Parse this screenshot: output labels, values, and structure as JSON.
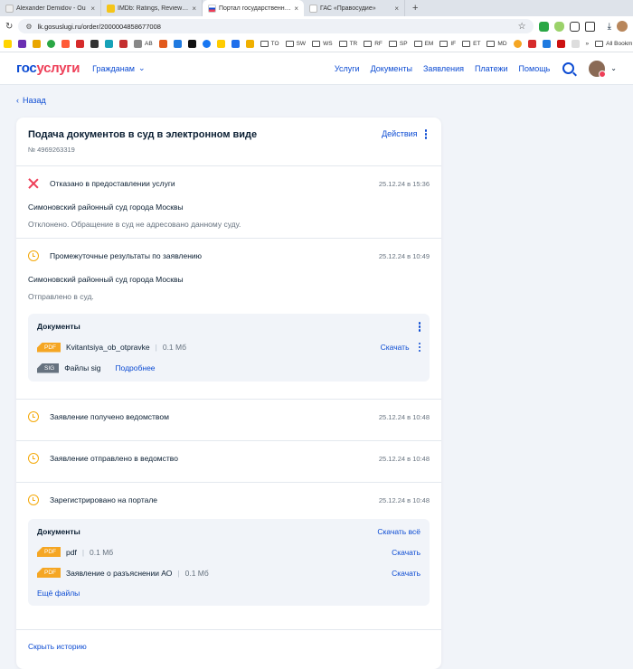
{
  "browser": {
    "tabs": [
      {
        "label": "Alexander Demidov - Ou",
        "active": false,
        "color": "#ffffff"
      },
      {
        "label": "IMDb: Ratings, Reviews, and W",
        "active": false,
        "color": "#f5c518"
      },
      {
        "label": "Портал государственных услу",
        "active": true,
        "color": "#0d4cd3"
      },
      {
        "label": "ГАС «Правосудие»",
        "active": false,
        "color": "#ffffff"
      }
    ],
    "url": "lk.gosuslugi.ru/order/2000004858677008",
    "bookmarks": [
      "AB",
      "TO",
      "SW",
      "WS",
      "TR",
      "RF",
      "SP",
      "EM",
      "IF",
      "ET",
      "MD"
    ],
    "all_bookmarks": "All Bookm"
  },
  "header": {
    "logo_a": "гос",
    "logo_b": "услуги",
    "role": "Гражданам",
    "nav": [
      "Услуги",
      "Документы",
      "Заявления",
      "Платежи",
      "Помощь"
    ]
  },
  "back": "Назад",
  "order": {
    "title": "Подача документов в суд в электронном виде",
    "number": "№ 4969263319",
    "actions": "Действия"
  },
  "events": {
    "refused": {
      "status": "Отказано в предоставлении услуги",
      "time": "25.12.24 в 15:36",
      "court": "Симоновский районный суд города Москвы",
      "note": "Отклонено. Обращение в суд не адресовано данному суду."
    },
    "interim": {
      "status": "Промежуточные результаты по заявлению",
      "time": "25.12.24 в 10:49",
      "court": "Симоновский районный суд города Москвы",
      "note": "Отправлено в суд.",
      "docs_title": "Документы",
      "doc1_type": "PDF",
      "doc1_name": "Kvitantsiya_ob_otpravke",
      "doc1_size": "0.1 Мб",
      "doc1_action": "Скачать",
      "doc2_type": "SIG",
      "doc2_name": "Файлы sig",
      "doc2_more": "Подробнее"
    },
    "received": {
      "status": "Заявление получено ведомством",
      "time": "25.12.24 в 10:48"
    },
    "sent": {
      "status": "Заявление отправлено в ведомство",
      "time": "25.12.24 в 10:48"
    },
    "registered": {
      "status": "Зарегистрировано на портале",
      "time": "25.12.24 в 10:48",
      "docs_title": "Документы",
      "download_all": "Скачать всё",
      "doc1_type": "PDF",
      "doc1_name": "pdf",
      "doc1_size": "0.1 Мб",
      "doc1_action": "Скачать",
      "doc2_type": "PDF",
      "doc2_name": "Заявление о разъяснении АО",
      "doc2_size": "0.1 Мб",
      "doc2_action": "Скачать",
      "more_files": "Ещё файлы"
    }
  },
  "hide_history": "Скрыть историю"
}
